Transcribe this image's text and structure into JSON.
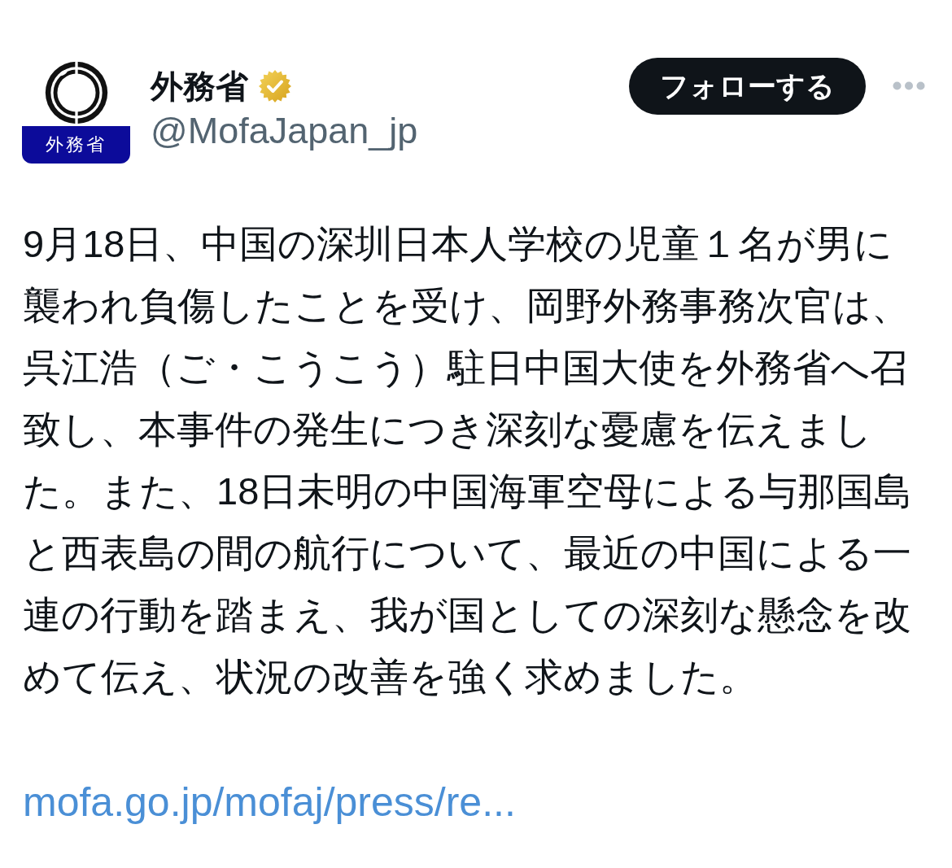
{
  "account": {
    "logo_label": "外務省",
    "name": "外務省",
    "verified": true,
    "handle": "@MofaJapan_jp"
  },
  "follow_button": {
    "label": "フォローする"
  },
  "post": {
    "text": "9月18日、中国の深圳日本人学校の児童１名が男に襲われ負傷したことを受け、岡野外務事務次官は、呉江浩（ご・こうこう）駐日中国大使を外務省へ召致し、本事件の発生につき深刻な憂慮を伝えました。また、18日未明の中国海軍空母による与那国島と西表島の間の航行について、最近の中国による一連の行動を踏まえ、我が国としての深刻な懸念を改めて伝え、状況の改善を強く求めました。",
    "link": "mofa.go.jp/mofaj/press/re..."
  }
}
